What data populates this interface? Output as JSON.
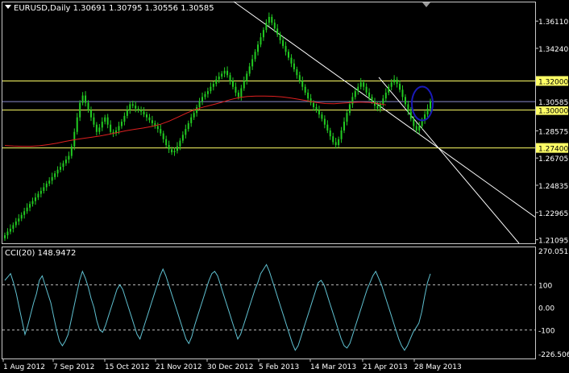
{
  "chart_data": [
    {
      "type": "candlestick",
      "symbol": "EURUSD",
      "timeframe": "Daily",
      "header": "EURUSD,Daily  1.30691 1.30795 1.30556 1.30585",
      "ohlc_last": {
        "open": 1.30691,
        "high": 1.30795,
        "low": 1.30556,
        "close": 1.30585
      },
      "ylim": [
        1.2085,
        1.3745
      ],
      "y_ticks": [
        "1.36110",
        "1.34240",
        "1.32000",
        "1.30585",
        "1.30000",
        "1.28575",
        "1.27400",
        "1.26705",
        "1.24835",
        "1.22965",
        "1.21095"
      ],
      "x_ticks": [
        "1 Aug 2012",
        "7 Sep 2012",
        "15 Oct 2012",
        "21 Nov 2012",
        "30 Dec 2012",
        "5 Feb 2013",
        "14 Mar 2013",
        "21 Apr 2013",
        "28 May 2013"
      ],
      "horizontal_levels": [
        {
          "value": 1.32,
          "label": "1.32000",
          "color": "#ffff66"
        },
        {
          "value": 1.3,
          "label": "1.30000",
          "color": "#ffff66"
        },
        {
          "value": 1.274,
          "label": "1.27400",
          "color": "#ffff66"
        }
      ],
      "current_price": {
        "value": 1.30585,
        "label": "1.30585",
        "color": "#8888cc"
      },
      "moving_average": {
        "color": "#e02020"
      },
      "candle_color": "#22cc22",
      "trend_line_color": "#ffffff",
      "highlight_ellipse_color": "#1a1ab8",
      "closes": [
        1.214,
        1.2165,
        1.2185,
        1.221,
        1.2235,
        1.2255,
        1.228,
        1.2305,
        1.233,
        1.2355,
        1.2375,
        1.24,
        1.2425,
        1.2445,
        1.247,
        1.2495,
        1.2515,
        1.254,
        1.2565,
        1.259,
        1.261,
        1.2635,
        1.266,
        1.2685,
        1.275,
        1.285,
        1.295,
        1.305,
        1.31,
        1.305,
        1.3,
        1.295,
        1.29,
        1.285,
        1.288,
        1.292,
        1.295,
        1.29,
        1.285,
        1.284,
        1.286,
        1.289,
        1.292,
        1.296,
        1.3,
        1.304,
        1.303,
        1.301,
        1.3,
        1.299,
        1.297,
        1.295,
        1.293,
        1.291,
        1.289,
        1.287,
        1.284,
        1.28,
        1.276,
        1.273,
        1.271,
        1.272,
        1.275,
        1.279,
        1.283,
        1.287,
        1.291,
        1.295,
        1.298,
        1.302,
        1.306,
        1.309,
        1.311,
        1.313,
        1.316,
        1.318,
        1.321,
        1.323,
        1.325,
        1.327,
        1.324,
        1.32,
        1.316,
        1.312,
        1.309,
        1.315,
        1.32,
        1.325,
        1.33,
        1.335,
        1.34,
        1.345,
        1.35,
        1.355,
        1.36,
        1.364,
        1.36,
        1.356,
        1.352,
        1.348,
        1.344,
        1.34,
        1.336,
        1.332,
        1.328,
        1.324,
        1.32,
        1.316,
        1.312,
        1.308,
        1.305,
        1.302,
        1.3,
        1.297,
        1.294,
        1.29,
        1.286,
        1.282,
        1.278,
        1.276,
        1.28,
        1.286,
        1.292,
        1.298,
        1.304,
        1.309,
        1.313,
        1.316,
        1.319,
        1.316,
        1.312,
        1.309,
        1.306,
        1.303,
        1.301,
        1.304,
        1.308,
        1.312,
        1.316,
        1.319,
        1.321,
        1.318,
        1.314,
        1.309,
        1.304,
        1.299,
        1.294,
        1.289,
        1.286,
        1.289,
        1.293,
        1.297,
        1.301,
        1.306
      ],
      "ma_values": [
        1.2757,
        1.2753,
        1.2751,
        1.2751,
        1.2755,
        1.2763,
        1.2773,
        1.2785,
        1.2796,
        1.2805,
        1.2813,
        1.2822,
        1.2833,
        1.2846,
        1.2858,
        1.2868,
        1.2877,
        1.2888,
        1.2903,
        1.2925,
        1.2952,
        1.298,
        1.3004,
        1.3022,
        1.3037,
        1.3053,
        1.3071,
        1.3085,
        1.3093,
        1.3096,
        1.3096,
        1.3095,
        1.3091,
        1.3083,
        1.3073,
        1.3063,
        1.3052,
        1.3045,
        1.3044,
        1.3048,
        1.3052,
        1.3055,
        1.3053,
        1.3046,
        1.3035
      ],
      "ma_x_range": [
        0,
        137
      ],
      "trend_lines": [
        {
          "x": [
            0.0,
            1.0
          ],
          "y": [
            1.3745,
            1.2085
          ]
        },
        {
          "x": [
            0.0,
            1.0
          ],
          "y": [
            1.3745,
            1.2085
          ]
        }
      ]
    },
    {
      "type": "line",
      "title": "CCI(20) 148.9472",
      "series_name": "CCI(20)",
      "last_value": 148.9472,
      "ylim": [
        -226.5064,
        270.051
      ],
      "y_ticks": [
        "270.051",
        "100",
        "0.00",
        "-100",
        "-226.5064"
      ],
      "levels": [
        100,
        -100
      ],
      "line_color": "#5fc0d0",
      "values": [
        120,
        135,
        150,
        110,
        60,
        0,
        -60,
        -120,
        -80,
        -30,
        20,
        60,
        120,
        140,
        100,
        60,
        20,
        -40,
        -100,
        -150,
        -170,
        -150,
        -120,
        -60,
        0,
        60,
        120,
        160,
        130,
        90,
        40,
        0,
        -60,
        -100,
        -110,
        -80,
        -40,
        0,
        40,
        80,
        100,
        80,
        40,
        0,
        -40,
        -80,
        -120,
        -140,
        -100,
        -60,
        -20,
        20,
        60,
        100,
        140,
        170,
        140,
        100,
        60,
        20,
        -20,
        -60,
        -100,
        -140,
        -160,
        -130,
        -80,
        -40,
        0,
        40,
        80,
        120,
        150,
        160,
        140,
        100,
        60,
        20,
        -20,
        -60,
        -100,
        -140,
        -120,
        -80,
        -40,
        0,
        40,
        80,
        110,
        150,
        170,
        190,
        160,
        120,
        80,
        40,
        0,
        -40,
        -80,
        -120,
        -160,
        -190,
        -170,
        -130,
        -90,
        -50,
        -10,
        30,
        70,
        110,
        120,
        100,
        60,
        20,
        -20,
        -60,
        -100,
        -140,
        -170,
        -180,
        -160,
        -120,
        -80,
        -40,
        0,
        40,
        80,
        110,
        140,
        160,
        130,
        100,
        60,
        20,
        -20,
        -60,
        -100,
        -140,
        -170,
        -190,
        -170,
        -140,
        -110,
        -90,
        -70,
        -20,
        50,
        110,
        149
      ]
    }
  ]
}
